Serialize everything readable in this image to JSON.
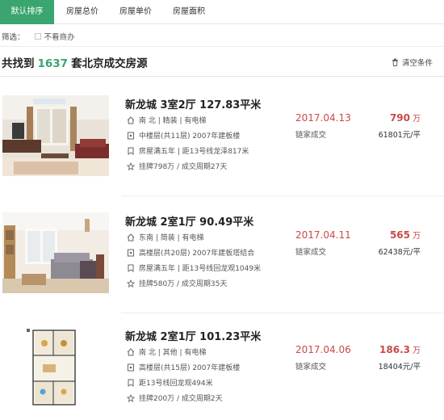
{
  "tabs": [
    {
      "label": "默认排序",
      "active": true
    },
    {
      "label": "房屋总价",
      "active": false
    },
    {
      "label": "房屋单价",
      "active": false
    },
    {
      "label": "房屋面积",
      "active": false
    }
  ],
  "filter": {
    "label": "筛选：",
    "checkbox_label": "不看商办",
    "checked": false
  },
  "summary": {
    "prefix": "共找到",
    "count": "1637",
    "suffix": "套北京成交房源",
    "clear_label": "清空条件"
  },
  "colors": {
    "accent": "#3aa56f",
    "price": "#c84a4a"
  },
  "listings": [
    {
      "title": "新龙城 3室2厅 127.83平米",
      "house_info": "南 北 | 精装 | 有电梯",
      "floor_info": "中楼层(共11层) 2007年建板楼",
      "tags_info": "房屋满五年 | 距13号线龙泽817米",
      "deal_info": "挂牌798万 / 成交周期27天",
      "deal_date": "2017.04.13",
      "agent": "链家成交",
      "total_price": "790",
      "price_unit": "万",
      "unit_price": "61801元/平",
      "icons": [
        "home-icon",
        "building-icon",
        "badge-icon",
        "tag-icon"
      ]
    },
    {
      "title": "新龙城 2室1厅 90.49平米",
      "house_info": "东南 | 简装 | 有电梯",
      "floor_info": "高楼层(共20层) 2007年建板塔结合",
      "tags_info": "房屋满五年 | 距13号线回龙观1049米",
      "deal_info": "挂牌580万 / 成交周期35天",
      "deal_date": "2017.04.11",
      "agent": "链家成交",
      "total_price": "565",
      "price_unit": "万",
      "unit_price": "62438元/平",
      "icons": [
        "home-icon",
        "building-icon",
        "badge-icon",
        "tag-icon"
      ]
    },
    {
      "title": "新龙城 2室1厅 101.23平米",
      "house_info": "南 北 | 其他 | 有电梯",
      "floor_info": "高楼层(共15层) 2007年建板楼",
      "tags_info": "距13号线回龙观494米",
      "deal_info": "挂牌200万 / 成交周期2天",
      "deal_date": "2017.04.06",
      "agent": "链家成交",
      "total_price": "186.3",
      "price_unit": "万",
      "unit_price": "18404元/平",
      "icons": [
        "home-icon",
        "building-icon",
        "badge-icon",
        "tag-icon"
      ]
    }
  ]
}
